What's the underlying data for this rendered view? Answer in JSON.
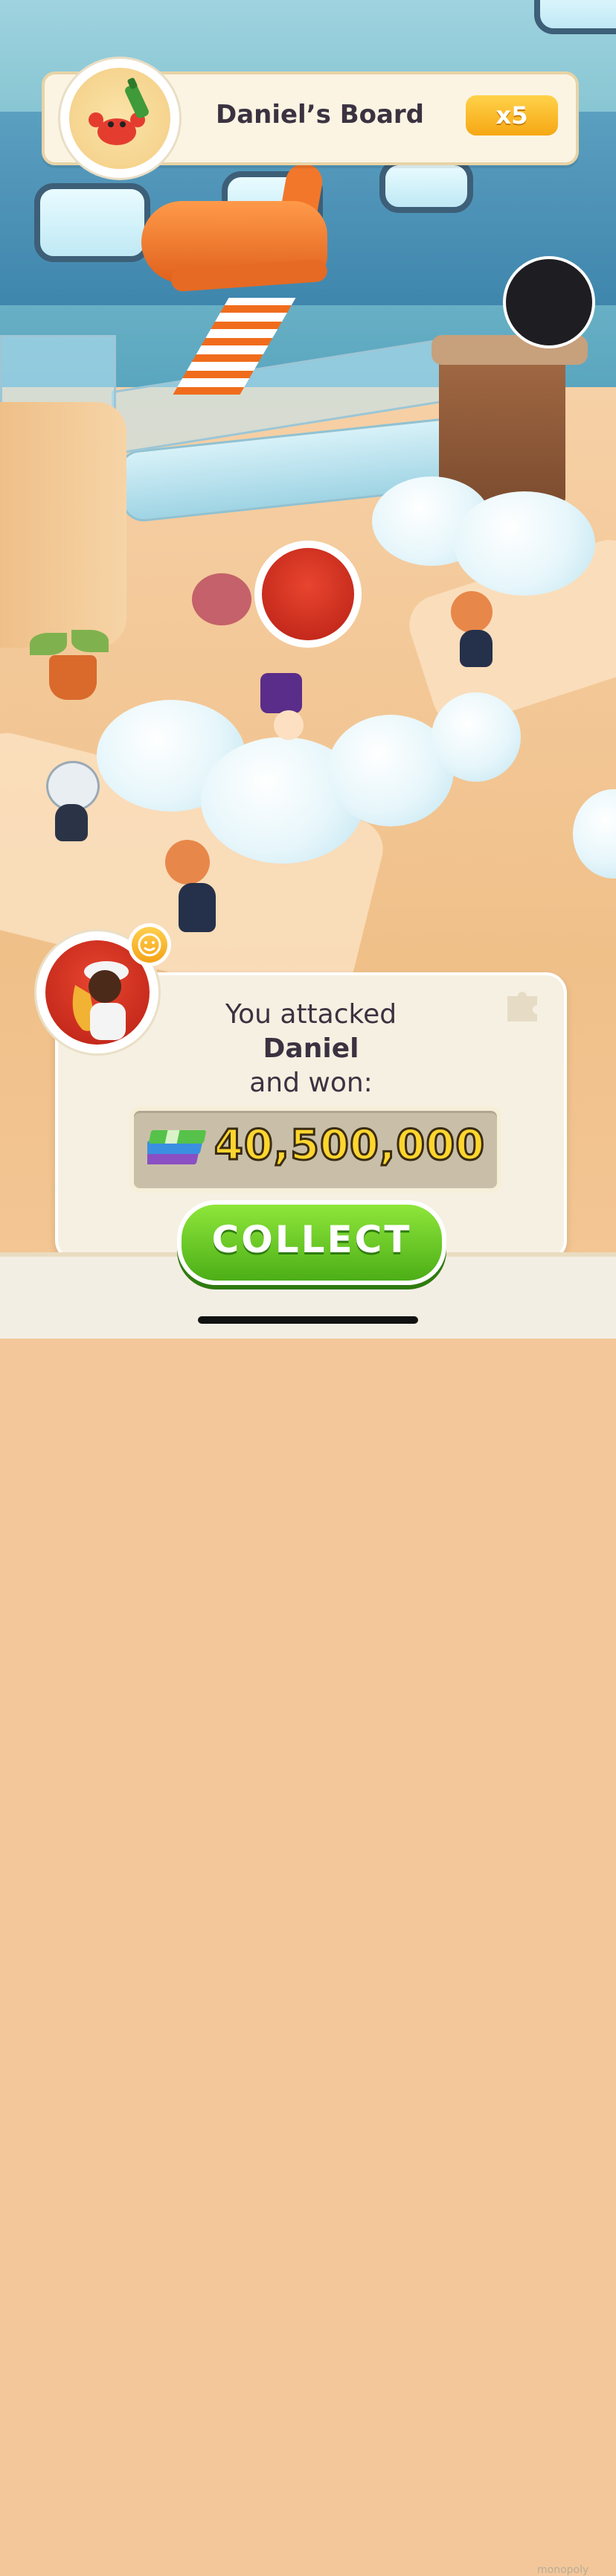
{
  "board_banner": {
    "title": "Daniel’s Board",
    "multiplier": "x5",
    "avatar_icon": "crab-with-bottle-icon"
  },
  "result_panel": {
    "line1": "You attacked",
    "line2": "Daniel",
    "line3": "and won:",
    "reward_amount": "40,500,000",
    "reward_icon": "cash-stack-icon",
    "winner_avatar_icon": "saxophone-player-icon",
    "emote_icon": "smiley-plus-icon",
    "puzzle_icon": "puzzle-piece-icon"
  },
  "collect_button": {
    "label": "COLLECT"
  },
  "watermark": "monopoly",
  "colors": {
    "accent_green": "#4cae17",
    "multiplier_gold": "#f6a714",
    "reward_gold": "#ffd52e",
    "avatar_red": "#b92015"
  }
}
